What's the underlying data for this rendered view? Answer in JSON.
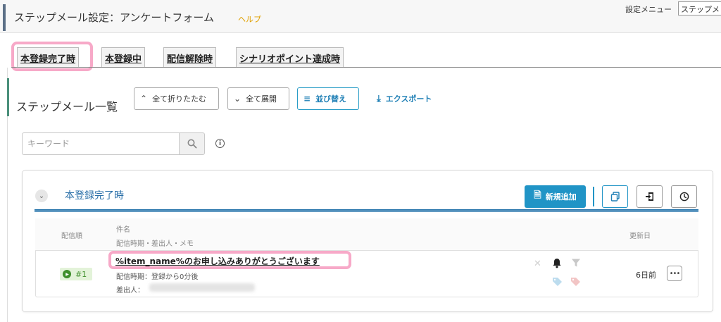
{
  "header": {
    "title": "ステップメール設定：アンケートフォーム",
    "help_label": "ヘルプ",
    "settings_menu_label": "設定メニュー",
    "settings_menu_value": "ステップメ"
  },
  "tabs": [
    {
      "label": "本登録完了時",
      "active": true
    },
    {
      "label": "本登録中",
      "active": false
    },
    {
      "label": "配信解除時",
      "active": false
    },
    {
      "label": "シナリオポイント達成時",
      "active": false
    }
  ],
  "list": {
    "title": "ステップメール一覧",
    "collapse_all_label": "全て折りたたむ",
    "expand_all_label": "全て展開",
    "sort_label": "並び替え",
    "export_label": "エクスポート"
  },
  "search": {
    "placeholder": "キーワード",
    "value": ""
  },
  "group": {
    "title": "本登録完了時",
    "new_add_label": "新規追加"
  },
  "table": {
    "columns": {
      "order": "配信順",
      "subject": "件名",
      "timing_sender_memo": "配信時期・差出人・メモ",
      "updated": "更新日"
    },
    "rows": [
      {
        "order": "#1",
        "subject": "%item_name%のお申し込みありがとうございます",
        "timing": "配信時期：登録から0分後",
        "sender_label": "差出人：",
        "updated": "6日前"
      }
    ]
  },
  "colors": {
    "accent_blue": "#2094c6",
    "highlight_pink": "#f7a9c8",
    "status_green": "#3f8f2b"
  },
  "icons": {
    "collapse_all": "chevron-up-icon",
    "expand_all": "chevron-down-icon",
    "sort": "sort-lines-icon",
    "export": "download-icon",
    "search": "magnifier-icon",
    "info": "info-icon",
    "new_add": "add-document-icon",
    "copy": "copy-icon",
    "import": "import-icon",
    "history": "clock-icon"
  }
}
